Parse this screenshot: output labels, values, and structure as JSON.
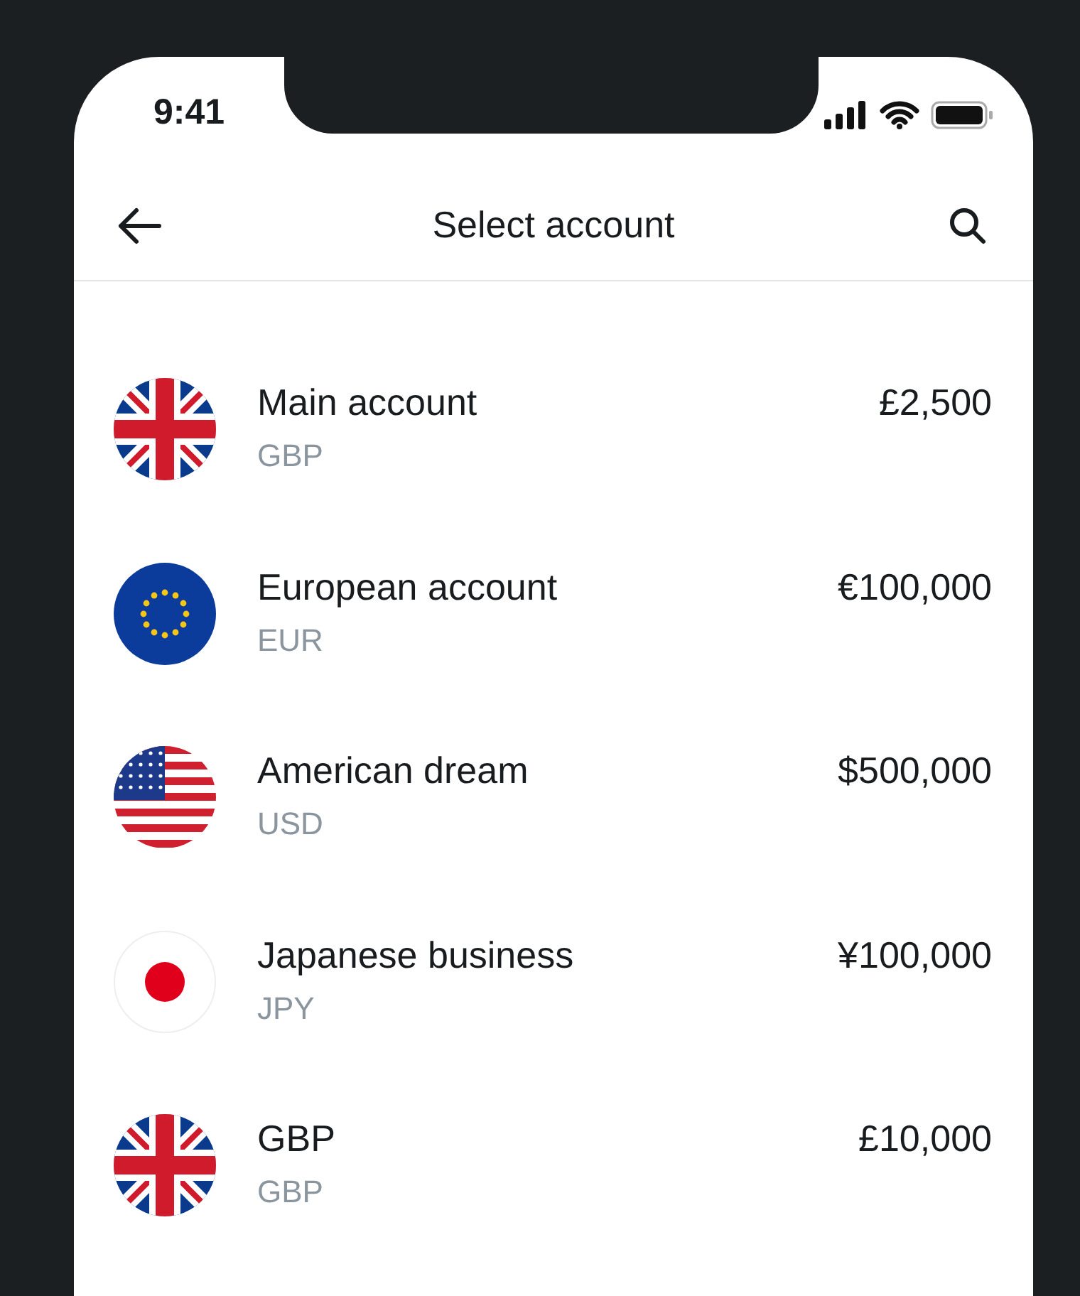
{
  "status_bar": {
    "time": "9:41"
  },
  "header": {
    "title": "Select account"
  },
  "accounts": [
    {
      "kind": "uk",
      "name": "Main account",
      "currency": "GBP",
      "balance": "£2,500"
    },
    {
      "kind": "eu",
      "name": "European account",
      "currency": "EUR",
      "balance": "€100,000"
    },
    {
      "kind": "us",
      "name": "American dream",
      "currency": "USD",
      "balance": "$500,000"
    },
    {
      "kind": "jp",
      "name": "Japanese business",
      "currency": "JPY",
      "balance": "¥100,000"
    },
    {
      "kind": "uk",
      "name": "GBP",
      "currency": "GBP",
      "balance": "£10,000"
    }
  ]
}
